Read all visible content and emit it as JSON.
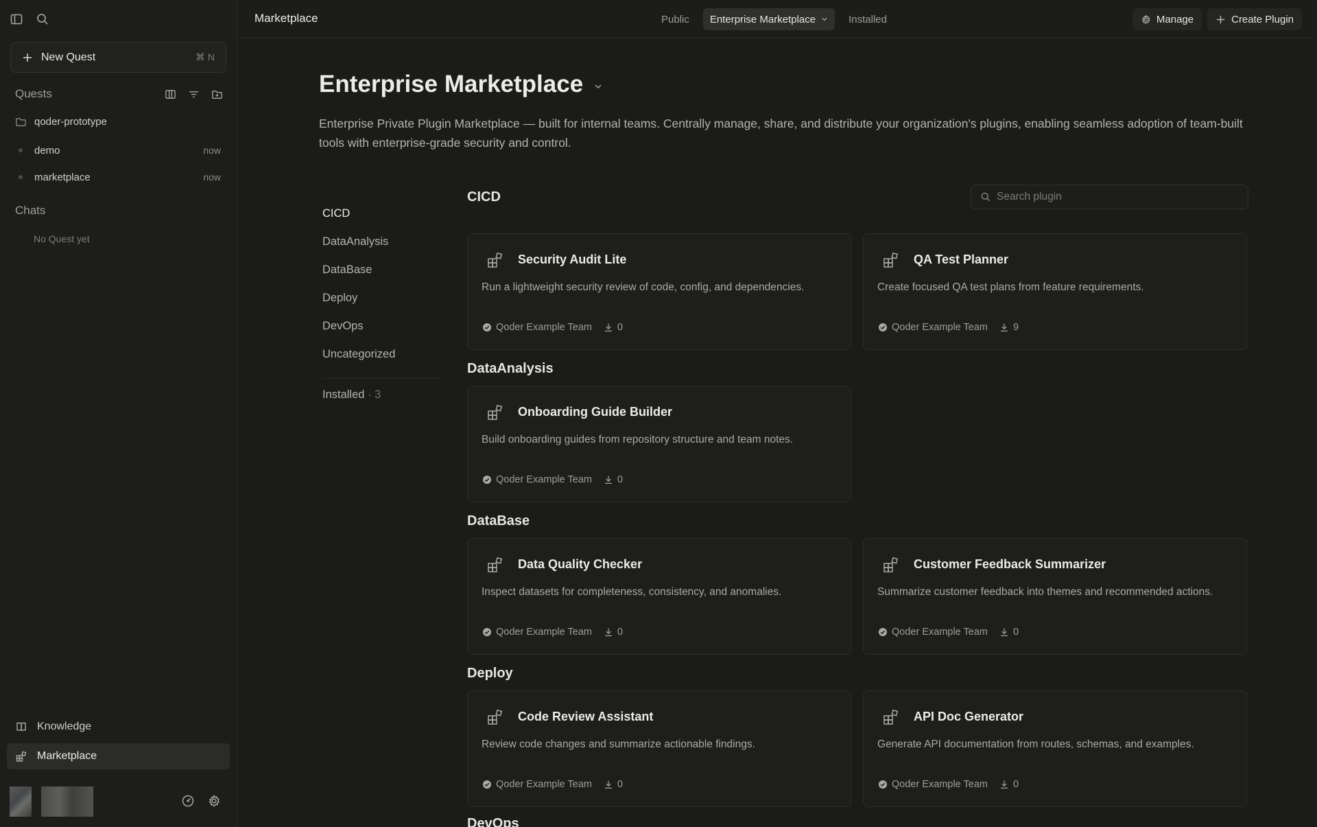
{
  "sidebar": {
    "new_quest": {
      "label": "New Quest",
      "shortcut": "⌘ N"
    },
    "quests_title": "Quests",
    "quests": [
      {
        "label": "qoder-prototype",
        "type": "folder",
        "time": ""
      },
      {
        "label": "demo",
        "type": "item",
        "time": "now"
      },
      {
        "label": "marketplace",
        "type": "item",
        "time": "now"
      }
    ],
    "chats_title": "Chats",
    "chats_empty": "No Quest yet",
    "nav": [
      {
        "label": "Knowledge",
        "icon": "book-icon",
        "active": false
      },
      {
        "label": "Marketplace",
        "icon": "grid-plugin-icon",
        "active": true
      }
    ]
  },
  "topbar": {
    "title": "Marketplace",
    "tabs": [
      {
        "label": "Public",
        "active": false
      },
      {
        "label": "Enterprise Marketplace",
        "active": true,
        "dropdown": true
      },
      {
        "label": "Installed",
        "active": false
      }
    ],
    "manage_label": "Manage",
    "create_label": "Create Plugin"
  },
  "page": {
    "title": "Enterprise Marketplace",
    "description": "Enterprise Private Plugin Marketplace — built for internal teams. Centrally manage, share, and distribute your organization's plugins, enabling seamless adoption of team-built tools with enterprise-grade security and control."
  },
  "categories": {
    "items": [
      "CICD",
      "DataAnalysis",
      "DataBase",
      "Deploy",
      "DevOps",
      "Uncategorized"
    ],
    "active": "CICD",
    "installed_label": "Installed",
    "installed_count": "· 3"
  },
  "search": {
    "placeholder": "Search plugin",
    "value": ""
  },
  "sections": [
    {
      "name": "CICD",
      "plugins": [
        {
          "title": "Security Audit Lite",
          "description": "Run a lightweight security review of code, config, and dependencies.",
          "author": "Qoder Example Team",
          "downloads": "0"
        },
        {
          "title": "QA Test Planner",
          "description": "Create focused QA test plans from feature requirements.",
          "author": "Qoder Example Team",
          "downloads": "9"
        }
      ]
    },
    {
      "name": "DataAnalysis",
      "plugins": [
        {
          "title": "Onboarding Guide Builder",
          "description": "Build onboarding guides from repository structure and team notes.",
          "author": "Qoder Example Team",
          "downloads": "0"
        }
      ]
    },
    {
      "name": "DataBase",
      "plugins": [
        {
          "title": "Data Quality Checker",
          "description": "Inspect datasets for completeness, consistency, and anomalies.",
          "author": "Qoder Example Team",
          "downloads": "0"
        },
        {
          "title": "Customer Feedback Summarizer",
          "description": "Summarize customer feedback into themes and recommended actions.",
          "author": "Qoder Example Team",
          "downloads": "0"
        }
      ]
    },
    {
      "name": "Deploy",
      "plugins": [
        {
          "title": "Code Review Assistant",
          "description": "Review code changes and summarize actionable findings.",
          "author": "Qoder Example Team",
          "downloads": "0"
        },
        {
          "title": "API Doc Generator",
          "description": "Generate API documentation from routes, schemas, and examples.",
          "author": "Qoder Example Team",
          "downloads": "0"
        }
      ]
    },
    {
      "name": "DevOps",
      "plugins": []
    }
  ]
}
